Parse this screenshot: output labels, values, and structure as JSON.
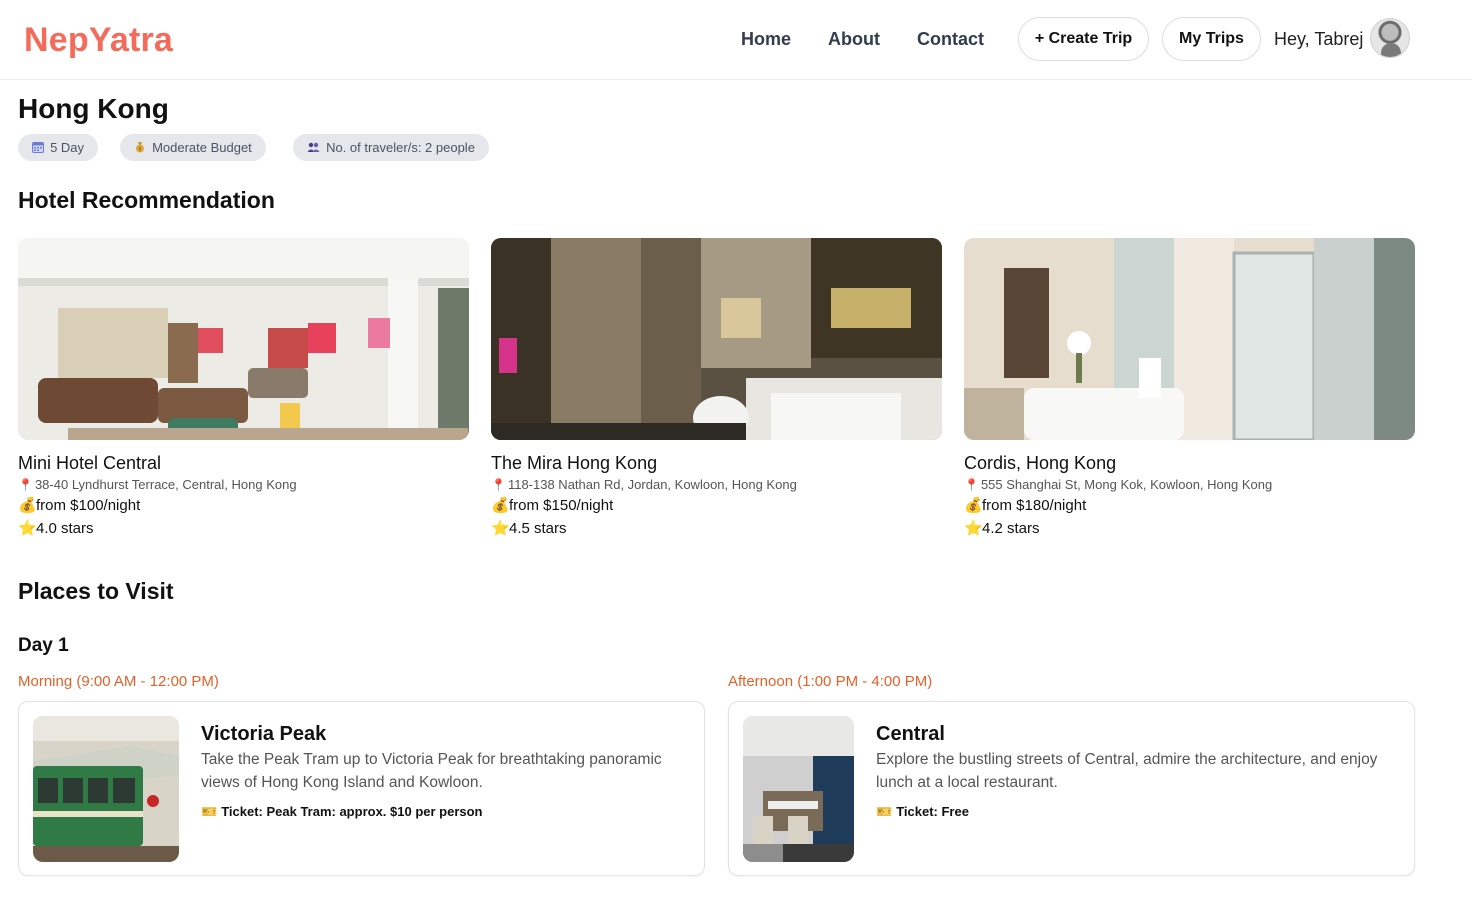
{
  "header": {
    "logo": "NepYatra",
    "nav": [
      "Home",
      "About",
      "Contact"
    ],
    "create_trip": "+ Create Trip",
    "my_trips": "My Trips",
    "greeting": "Hey, Tabrej"
  },
  "trip": {
    "title": "Hong Kong",
    "tags": [
      {
        "icon": "calendar-icon",
        "label": "5 Day"
      },
      {
        "icon": "money-bag-icon",
        "label": "Moderate Budget"
      },
      {
        "icon": "people-icon",
        "label": "No. of traveler/s: 2 people"
      }
    ]
  },
  "hotels_section": {
    "title": "Hotel Recommendation",
    "hotels": [
      {
        "name": "Mini Hotel Central",
        "address": "38-40 Lyndhurst Terrace, Central, Hong Kong",
        "price": "from $100/night",
        "rating": "4.0 stars"
      },
      {
        "name": "The Mira Hong Kong",
        "address": "118-138 Nathan Rd, Jordan, Kowloon, Hong Kong",
        "price": "from $150/night",
        "rating": "4.5 stars"
      },
      {
        "name": "Cordis, Hong Kong",
        "address": "555 Shanghai St, Mong Kok, Kowloon, Hong Kong",
        "price": "from $180/night",
        "rating": "4.2 stars"
      }
    ]
  },
  "places_section": {
    "title": "Places to Visit",
    "day": "Day 1",
    "slots": [
      {
        "time": "Morning (9:00 AM - 12:00 PM)",
        "name": "Victoria Peak",
        "desc_line1": "Take the Peak Tram up to Victoria Peak for breathtaking panoramic",
        "desc_line2": "views of Hong Kong Island and Kowloon.",
        "ticket": "Ticket: Peak Tram: approx. $10 per person"
      },
      {
        "time": "Afternoon (1:00 PM - 4:00 PM)",
        "name": "Central",
        "desc_line1": "Explore the bustling streets of Central, admire the architecture, and enjoy",
        "desc_line2": "lunch at a local restaurant.",
        "ticket": "Ticket: Free"
      }
    ]
  },
  "colors": {
    "brand": "#f26b5b",
    "slot_time": "#e0622a",
    "tag_bg": "#e5e7eb"
  }
}
